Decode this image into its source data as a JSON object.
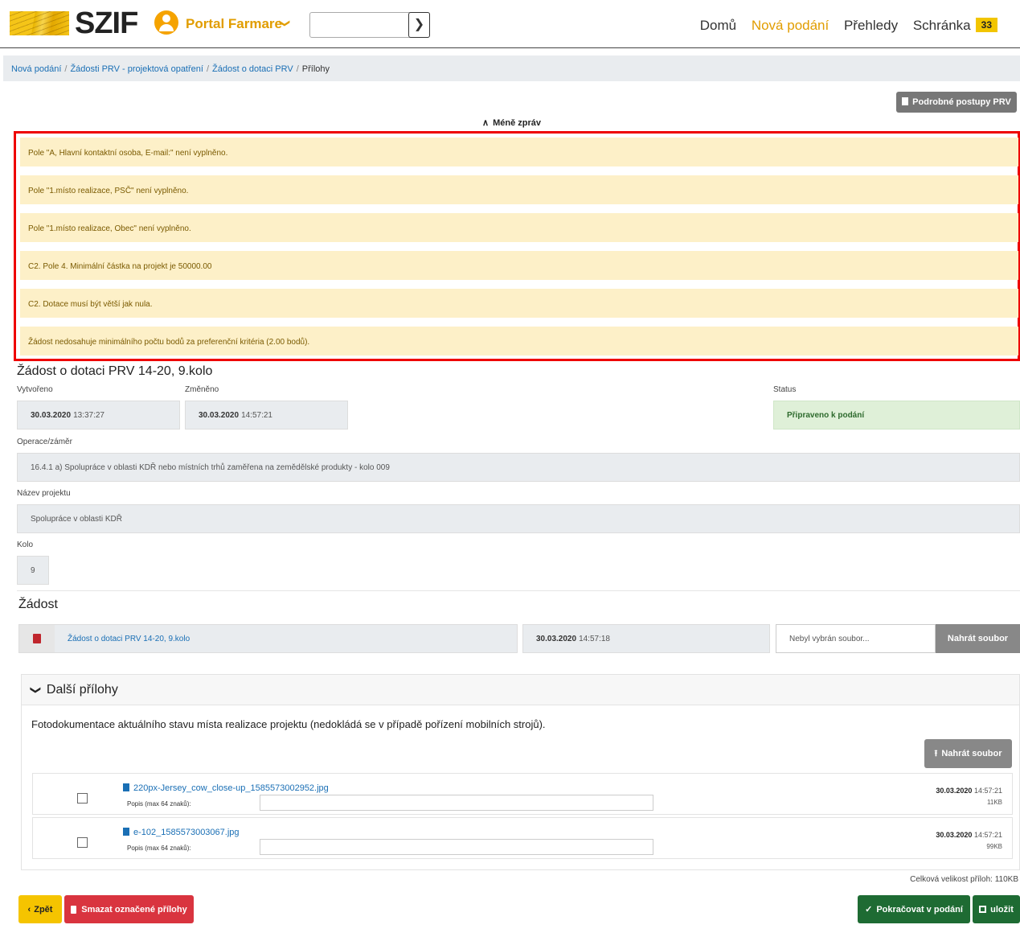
{
  "header": {
    "logo_text": "SZIF",
    "portal_title": "Portal Farmare",
    "portal_chevron": "❯",
    "search_placeholder": "",
    "search_button": "❯",
    "nav": [
      {
        "label": "Domů"
      },
      {
        "label": "Nová podání"
      },
      {
        "label": "Přehledy"
      },
      {
        "label": "Schránka"
      }
    ],
    "inbox_count": "33"
  },
  "breadcrumb": [
    "Nová podání",
    "Žádosti PRV - projektová opatření",
    "Žádost o dotaci PRV",
    "Přílohy"
  ],
  "buttons": {
    "detailed_procedures": "Podrobné postupy PRV",
    "less_messages": "Méně zpráv",
    "upload_file": "Nahrát soubor",
    "upload_file_2": "Nahrát soubor",
    "back": "Zpět",
    "delete_selected": "Smazat označené přílohy",
    "continue": "Pokračovat v podání",
    "save": "uložit"
  },
  "alerts": [
    "Pole \"A, Hlavní kontaktní osoba, E-mail:\" není vyplněno.",
    "Pole \"1.místo realizace, PSČ\" není vyplněno.",
    "Pole \"1.místo realizace, Obec\" není vyplněno.",
    "C2. Pole 4. Minimální částka na projekt je 50000.00",
    "C2. Dotace musí být větší jak nula.",
    "Žádost nedosahuje minimálního počtu bodů za preferenční kritéria (2.00 bodů)."
  ],
  "application": {
    "title": "Žádost o dotaci PRV 14-20, 9.kolo",
    "created_label": "Vytvořeno",
    "created_date": "30.03.2020",
    "created_time": "13:37:27",
    "changed_label": "Změněno",
    "changed_date": "30.03.2020",
    "changed_time": "14:57:21",
    "status_label": "Status",
    "status_value": "Připraveno k podání",
    "operation_label": "Operace/záměr",
    "operation_value": "16.4.1 a) Spolupráce v oblasti KDŘ nebo místních trhů zaměřena na zemědělské produkty - kolo 009",
    "project_label": "Název projektu",
    "project_value": "Spolupráce v oblasti KDŘ",
    "round_label": "Kolo",
    "round_value": "9"
  },
  "request": {
    "heading": "Žádost",
    "file_name": "Žádost o dotaci PRV 14-20, 9.kolo",
    "file_date": "30.03.2020",
    "file_time": "14:57:18",
    "no_file_text": "Nebyl vybrán soubor..."
  },
  "attachments": {
    "heading": "Další přílohy",
    "description": "Fotodokumentace aktuálního stavu místa realizace projektu (nedokládá se v případě pořízení mobilních strojů).",
    "popis_label": "Popis (max 64 znaků):",
    "items": [
      {
        "name": "220px-Jersey_cow_close-up_1585573002952.jpg",
        "date": "30.03.2020",
        "time": "14:57:21",
        "size": "11KB"
      },
      {
        "name": "e-102_1585573003067.jpg",
        "date": "30.03.2020",
        "time": "14:57:21",
        "size": "99KB"
      }
    ],
    "total_size": "Celková velikost příloh: 110KB"
  }
}
